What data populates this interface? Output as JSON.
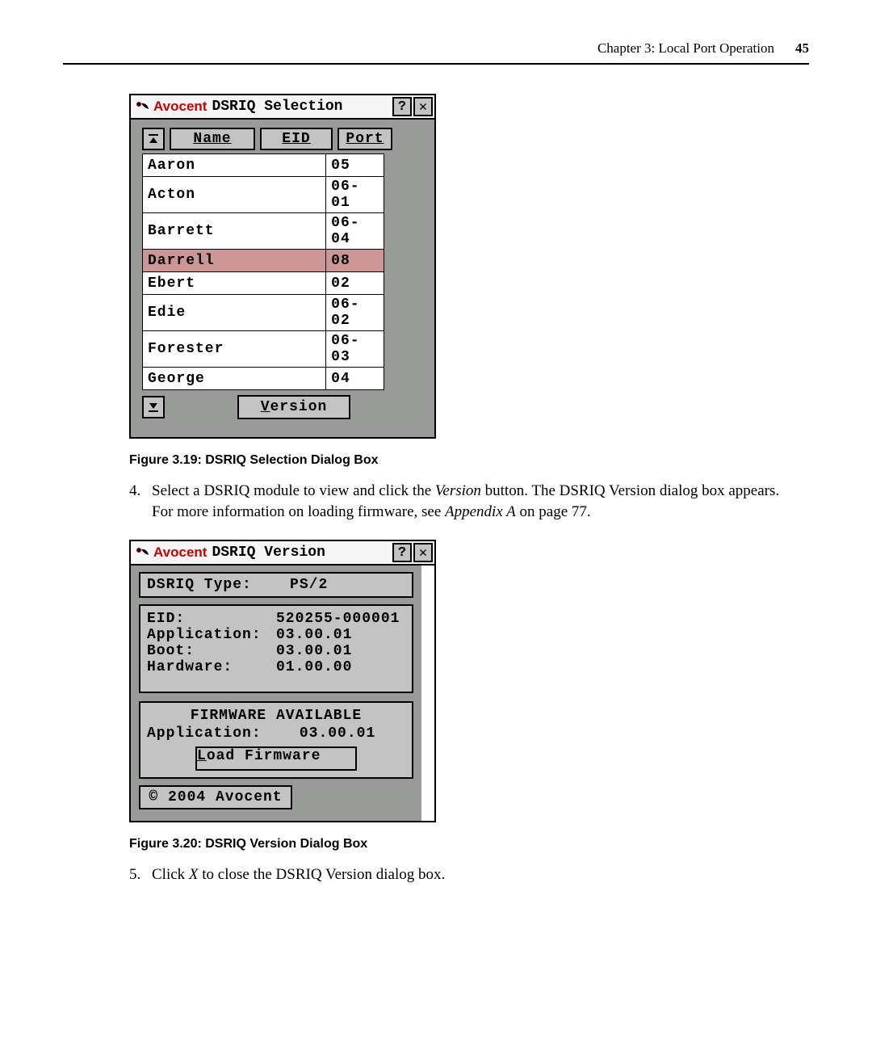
{
  "header": {
    "chapter": "Chapter 3: Local Port Operation",
    "page": "45"
  },
  "selection_dialog": {
    "brand": "Avocent",
    "title": " DSRIQ Selection ",
    "help_glyph": "?",
    "close_glyph": "✕",
    "scroll_up_glyph": "▔▲▔",
    "scroll_down_glyph": "▁▼▁",
    "col_name": "Name",
    "col_eid": "EID",
    "col_port": "Port",
    "rows": [
      {
        "name": "Aaron",
        "port": "05",
        "selected": false
      },
      {
        "name": "Acton",
        "port": "06-01",
        "selected": false
      },
      {
        "name": "Barrett",
        "port": "06-04",
        "selected": false
      },
      {
        "name": "Darrell",
        "port": "08",
        "selected": true
      },
      {
        "name": "Ebert",
        "port": "02",
        "selected": false
      },
      {
        "name": "Edie",
        "port": "06-02",
        "selected": false
      },
      {
        "name": "Forester",
        "port": "06-03",
        "selected": false
      },
      {
        "name": "George",
        "port": "04",
        "selected": false
      }
    ],
    "version_btn": "Version"
  },
  "caption1": "Figure 3.19: DSRIQ Selection Dialog Box",
  "step4": {
    "num": "4.",
    "text_pre": "Select a DSRIQ module to view and click the ",
    "italic1": "Version",
    "text_mid": " button. The DSRIQ Version dialog box appears. For more information on loading firmware, see ",
    "italic2": "Appendix A",
    "text_post": " on page 77."
  },
  "version_dialog": {
    "brand": "Avocent",
    "title": " DSRIQ Version",
    "help_glyph": "?",
    "close_glyph": "✕",
    "type_label": "DSRIQ Type:",
    "type_value": "PS/2",
    "eid_label": "EID:",
    "eid_value": "520255-000001",
    "app_label": "Application:",
    "app_value": "03.00.01",
    "boot_label": "Boot:",
    "boot_value": "03.00.01",
    "hw_label": "Hardware:",
    "hw_value": "01.00.00",
    "fw_heading": "FIRMWARE AVAILABLE",
    "fw_app_label": "Application:",
    "fw_app_value": "03.00.01",
    "load_btn": "Load Firmware",
    "copyright": "© 2004 Avocent"
  },
  "caption2": "Figure 3.20: DSRIQ Version Dialog Box",
  "step5": {
    "num": "5.",
    "text_pre": "Click ",
    "italic1": "X",
    "text_post": " to close the DSRIQ Version dialog box."
  }
}
